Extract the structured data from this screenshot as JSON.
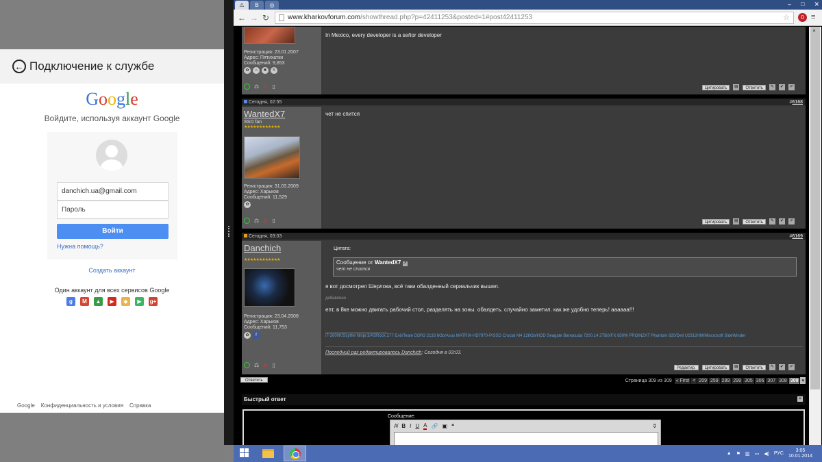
{
  "left_panel": {
    "title": "Подключение к службе",
    "logo": {
      "letters": [
        "G",
        "o",
        "o",
        "g",
        "l",
        "e"
      ],
      "colors": [
        "#3c74d6",
        "#d63a2f",
        "#f0b400",
        "#3c74d6",
        "#2c9a41",
        "#d63a2f"
      ]
    },
    "subtitle": "Войдите, используя аккаунт Google",
    "email_value": "danchich.ua@gmail.com",
    "password_placeholder": "Пароль",
    "signin_label": "Войти",
    "help_link": "Нужна помощь?",
    "create_account": "Создать аккаунт",
    "one_account_text": "Один аккаунт для всех сервисов Google",
    "services": [
      {
        "icon": "google-plus-icon",
        "glyph": "g",
        "color": "#4a7ee3"
      },
      {
        "icon": "gmail-icon",
        "glyph": "M",
        "color": "#d14836"
      },
      {
        "icon": "drive-icon",
        "glyph": "▲",
        "color": "#3a9b47"
      },
      {
        "icon": "youtube-icon",
        "glyph": "▶",
        "color": "#d02b20"
      },
      {
        "icon": "maps-icon",
        "glyph": "◆",
        "color": "#e7b34a"
      },
      {
        "icon": "play-icon",
        "glyph": "▶",
        "color": "#40b466"
      },
      {
        "icon": "gplus-icon",
        "glyph": "g+",
        "color": "#d0442c"
      }
    ],
    "footer": [
      "Google",
      "Конфиденциальность и условия",
      "Справка"
    ]
  },
  "browser": {
    "url_host": "www.kharkovforum.com",
    "url_path": "/showthread.php?p=42411253&posted=1#post42411253",
    "window_controls": [
      "–",
      "□",
      "✕"
    ]
  },
  "posts": [
    {
      "date": "",
      "number": "",
      "user": {
        "registration": "Регистрация: 23.01.2007",
        "address": "Адрес: Пятихатки",
        "messages": "Сообщений: 9,853"
      },
      "message": "In Mexico, every developer is a señor developer",
      "buttons": [
        "Цитировать",
        "Ответить"
      ]
    },
    {
      "date": "Сегодня, 02:55",
      "number": "6168",
      "user": {
        "name": "WantedX7",
        "title": "SSD fan",
        "stars": "★★★★★★★★★★★★",
        "registration": "Регистрация: 31.03.2009",
        "address": "Адрес: Харьков",
        "messages": "Сообщений: 11,529"
      },
      "message": "чет не спится",
      "buttons": [
        "Цитировать",
        "Ответить"
      ]
    },
    {
      "date": "Сегодня, 03:03",
      "number": "6169",
      "user": {
        "name": "Danchich",
        "stars": "★★★★★★★★★★★★",
        "registration": "Регистрация: 23.04.2008",
        "address": "Адрес: Харьков",
        "messages": "Сообщений: 11,753"
      },
      "quote_label": "Цитата:",
      "quote_from_prefix": "Сообщение от",
      "quote_author": "WantedX7",
      "quote_text": "чет не спится",
      "message1": "я вот досмотрел Шерлока, всё таки обалденный сериальчик вышел.",
      "added": "добавлено",
      "message2": "епт, в 8ке можно двигать рабочий стол, разделять на зоны. обалдеть. случайно заметил. как же удобно теперь! аааааа!!!",
      "signature": "i7-2600K/Scythe Ninja 3/ASRock Z77 Ex6/Team DDR3 2133 8Gb/Asus MATRIX-HD7970-P/SSD Crucial M4 128Gb/HDD Seagate Barracuda 7200.14 2TB/XFX 850W PRO/NZXT Phantom 820/Dell U2312HM/Mixcrosoft SideWinder",
      "edited_prefix": "Последний раз редактировалось Danchich",
      "edited_suffix": "; Сегодня в 03:03.",
      "buttons": [
        "Редактир.",
        "Цитировать",
        "Ответить"
      ]
    }
  ],
  "pagination": {
    "reply_label": "Ответить",
    "info": "Страница 309 из 309",
    "first": "« First",
    "prev": "<",
    "pages": [
      "209",
      "259",
      "289",
      "299",
      "305",
      "306",
      "307",
      "308"
    ],
    "current": "309"
  },
  "quick_reply": {
    "title": "Быстрый ответ",
    "message_label": "Сообщение:"
  },
  "taskbar": {
    "lang": "РУС",
    "time": "3:05",
    "date": "10.01.2014"
  }
}
